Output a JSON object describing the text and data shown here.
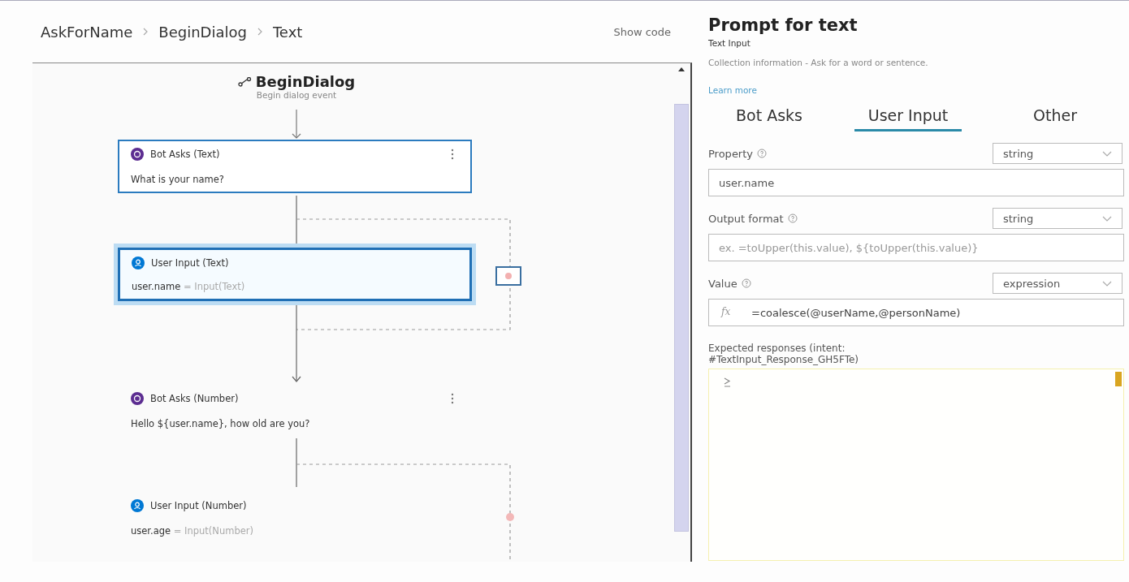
{
  "breadcrumb": [
    {
      "label": "AskForName"
    },
    {
      "label": "BeginDialog"
    },
    {
      "label": "Text"
    }
  ],
  "show_code": "Show code",
  "canvas": {
    "trigger": {
      "title": "BeginDialog",
      "subtitle": "Begin dialog event"
    },
    "nodes": [
      {
        "kind": "bot_asks",
        "title": "Bot Asks (Text)",
        "outlined": true,
        "selected": false,
        "menu": true,
        "body": "What is your name?"
      },
      {
        "kind": "user_input",
        "title": "User Input (Text)",
        "outlined": true,
        "selected": true,
        "menu": false,
        "variable": "user.name",
        "expression": "= Input(Text)"
      },
      {
        "kind": "bot_asks",
        "title": "Bot Asks (Number)",
        "outlined": false,
        "selected": false,
        "menu": true,
        "body": "Hello ${user.name}, how old are you?"
      },
      {
        "kind": "user_input",
        "title": "User Input (Number)",
        "outlined": false,
        "selected": false,
        "menu": false,
        "variable": "user.age",
        "expression": "= Input(Number)"
      }
    ]
  },
  "panel": {
    "title": "Prompt for text",
    "subtitle": "Text Input",
    "description": "Collection information - Ask for a word or sentence.",
    "link": "Learn more",
    "tabs": [
      {
        "label": "Bot Asks",
        "selected": false
      },
      {
        "label": "User Input",
        "selected": true
      },
      {
        "label": "Other",
        "selected": false
      }
    ],
    "fields": [
      {
        "kind": "text",
        "label": "Property",
        "type": "string",
        "value": "user.name"
      },
      {
        "kind": "text",
        "label": "Output format",
        "type": "string",
        "placeholder": "ex. =toUpper(this.value), ${toUpper(this.value)}"
      },
      {
        "kind": "expression",
        "label": "Value",
        "type": "expression",
        "prefix": "fx",
        "value": "=coalesce(@userName,@personName)"
      }
    ],
    "responses": {
      "label": "Expected responses (intent: #TextInput_Response_GH5FTe)"
    }
  }
}
